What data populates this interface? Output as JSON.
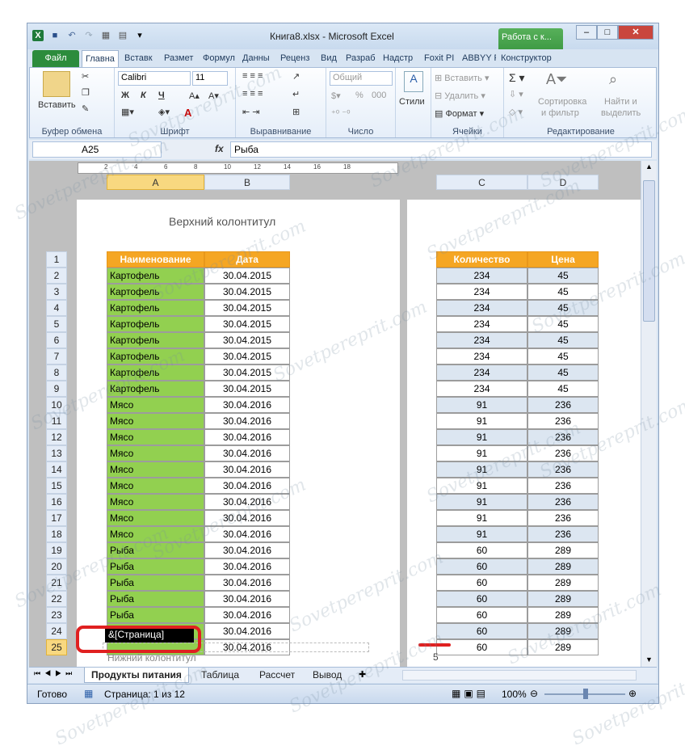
{
  "window": {
    "title": "Книга8.xlsx - Microsoft Excel",
    "context_tab": "Работа с к...",
    "context_tab_sub": "Конструктор"
  },
  "ribbon": {
    "tabs": [
      "Файл",
      "Главна",
      "Вставк",
      "Размет",
      "Формул",
      "Данны",
      "Реценз",
      "Вид",
      "Разраб",
      "Надстр",
      "Foxit PI",
      "ABBYY F",
      "Конструктор"
    ],
    "clipboard": {
      "paste": "Вставить",
      "label": "Буфер обмена"
    },
    "font": {
      "name": "Calibri",
      "size": "11",
      "bold": "Ж",
      "italic": "К",
      "underline": "Ч",
      "label": "Шрифт"
    },
    "alignment": {
      "label": "Выравнивание"
    },
    "number": {
      "format": "Общий",
      "percent": "%",
      "thousands": "000",
      "label": "Число"
    },
    "styles": {
      "label": "Стили"
    },
    "cells": {
      "insert": "Вставить",
      "delete": "Удалить",
      "format": "Формат",
      "label": "Ячейки"
    },
    "editing": {
      "sort": "Сортировка",
      "sort2": "и фильтр",
      "find": "Найти и",
      "find2": "выделить",
      "label": "Редактирование"
    }
  },
  "formula_bar": {
    "name_box": "A25",
    "fx": "fx",
    "value": "Рыба"
  },
  "ruler": [
    "2",
    "4",
    "6",
    "8",
    "10",
    "12",
    "14",
    "16",
    "18"
  ],
  "columns_left": [
    "A",
    "B"
  ],
  "columns_right": [
    "C",
    "D"
  ],
  "header_text": "Верхний колонтитул",
  "footer_text": "Нижний колонтитул",
  "footer_edit": "&[Страница]",
  "footer_right": "5",
  "table": {
    "headers": [
      "Наименование",
      "Дата",
      "Количество",
      "Цена"
    ],
    "rows": [
      [
        "Картофель",
        "30.04.2015",
        "234",
        "45"
      ],
      [
        "Картофель",
        "30.04.2015",
        "234",
        "45"
      ],
      [
        "Картофель",
        "30.04.2015",
        "234",
        "45"
      ],
      [
        "Картофель",
        "30.04.2015",
        "234",
        "45"
      ],
      [
        "Картофель",
        "30.04.2015",
        "234",
        "45"
      ],
      [
        "Картофель",
        "30.04.2015",
        "234",
        "45"
      ],
      [
        "Картофель",
        "30.04.2015",
        "234",
        "45"
      ],
      [
        "Картофель",
        "30.04.2015",
        "234",
        "45"
      ],
      [
        "Мясо",
        "30.04.2016",
        "91",
        "236"
      ],
      [
        "Мясо",
        "30.04.2016",
        "91",
        "236"
      ],
      [
        "Мясо",
        "30.04.2016",
        "91",
        "236"
      ],
      [
        "Мясо",
        "30.04.2016",
        "91",
        "236"
      ],
      [
        "Мясо",
        "30.04.2016",
        "91",
        "236"
      ],
      [
        "Мясо",
        "30.04.2016",
        "91",
        "236"
      ],
      [
        "Мясо",
        "30.04.2016",
        "91",
        "236"
      ],
      [
        "Мясо",
        "30.04.2016",
        "91",
        "236"
      ],
      [
        "Мясо",
        "30.04.2016",
        "91",
        "236"
      ],
      [
        "Рыба",
        "30.04.2016",
        "60",
        "289"
      ],
      [
        "Рыба",
        "30.04.2016",
        "60",
        "289"
      ],
      [
        "Рыба",
        "30.04.2016",
        "60",
        "289"
      ],
      [
        "Рыба",
        "30.04.2016",
        "60",
        "289"
      ],
      [
        "Рыба",
        "30.04.2016",
        "60",
        "289"
      ],
      [
        "Рыба",
        "30.04.2016",
        "60",
        "289"
      ],
      [
        "",
        "30.04.2016",
        "60",
        "289"
      ]
    ]
  },
  "sheet_tabs": [
    "Продукты питания",
    "Таблица",
    "Рассчет",
    "Вывод"
  ],
  "status": {
    "ready": "Готово",
    "page": "Страница: 1 из 12",
    "zoom": "100%"
  },
  "watermark": "Sovetpereprit.com"
}
